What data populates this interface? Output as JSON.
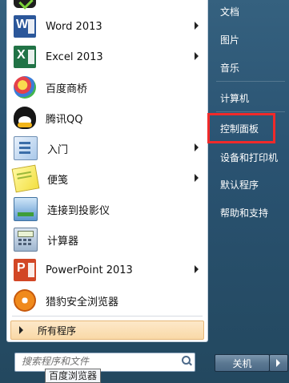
{
  "left_pane": {
    "programs": [
      {
        "label": "Word 2013",
        "has_submenu": true,
        "icon": "word-icon"
      },
      {
        "label": "Excel 2013",
        "has_submenu": true,
        "icon": "excel-icon"
      },
      {
        "label": "百度商桥",
        "has_submenu": false,
        "icon": "baidu-shangqiao-icon"
      },
      {
        "label": "腾讯QQ",
        "has_submenu": false,
        "icon": "qq-icon"
      },
      {
        "label": "入门",
        "has_submenu": true,
        "icon": "getting-started-icon"
      },
      {
        "label": "便笺",
        "has_submenu": true,
        "icon": "sticky-notes-icon"
      },
      {
        "label": "连接到投影仪",
        "has_submenu": false,
        "icon": "projector-icon"
      },
      {
        "label": "计算器",
        "has_submenu": false,
        "icon": "calculator-icon"
      },
      {
        "label": "PowerPoint 2013",
        "has_submenu": true,
        "icon": "powerpoint-icon"
      },
      {
        "label": "猎豹安全浏览器",
        "has_submenu": false,
        "icon": "liebao-browser-icon"
      }
    ],
    "all_programs": "所有程序"
  },
  "search": {
    "placeholder": "搜索程序和文件"
  },
  "tooltip": "百度浏览器",
  "right_pane": {
    "items": [
      {
        "label": "文档"
      },
      {
        "label": "图片"
      },
      {
        "label": "音乐"
      },
      {
        "label": "计算机"
      },
      {
        "label": "控制面板"
      },
      {
        "label": "设备和打印机"
      },
      {
        "label": "默认程序"
      },
      {
        "label": "帮助和支持"
      }
    ],
    "highlighted_item": "控制面板",
    "highlight_color": "#f02a2a"
  },
  "shutdown": {
    "label": "关机"
  }
}
